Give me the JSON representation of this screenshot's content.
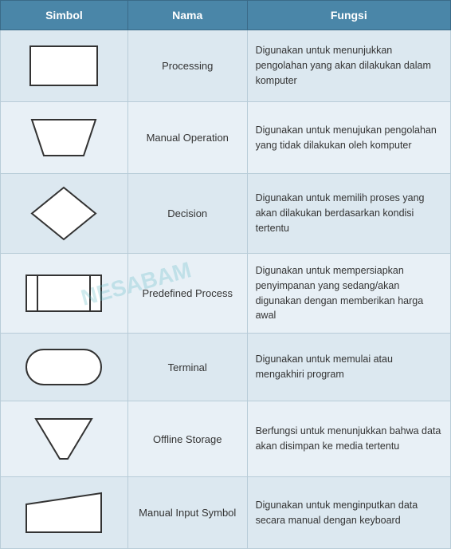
{
  "header": {
    "col1": "Simbol",
    "col2": "Nama",
    "col3": "Fungsi"
  },
  "rows": [
    {
      "name": "Processing",
      "func": "Digunakan untuk menunjukkan pengolahan yang akan dilakukan dalam komputer"
    },
    {
      "name": "Manual Operation",
      "func": "Digunakan untuk menujukan pengolahan yang tidak dilakukan oleh komputer"
    },
    {
      "name": "Decision",
      "func": "Digunakan untuk memilih proses yang akan dilakukan berdasarkan kondisi tertentu"
    },
    {
      "name": "Predefined Process",
      "func": "Digunakan untuk mempersiapkan penyimpanan yang sedang/akan digunakan dengan memberikan harga awal"
    },
    {
      "name": "Terminal",
      "func": "Digunakan untuk memulai atau mengakhiri program"
    },
    {
      "name": "Offline Storage",
      "func": "Berfungsi untuk menunjukkan bahwa data akan disimpan ke media tertentu"
    },
    {
      "name": "Manual Input Symbol",
      "func": "Digunakan untuk menginputkan data secara manual dengan keyboard"
    }
  ],
  "watermark": "NESABAM"
}
